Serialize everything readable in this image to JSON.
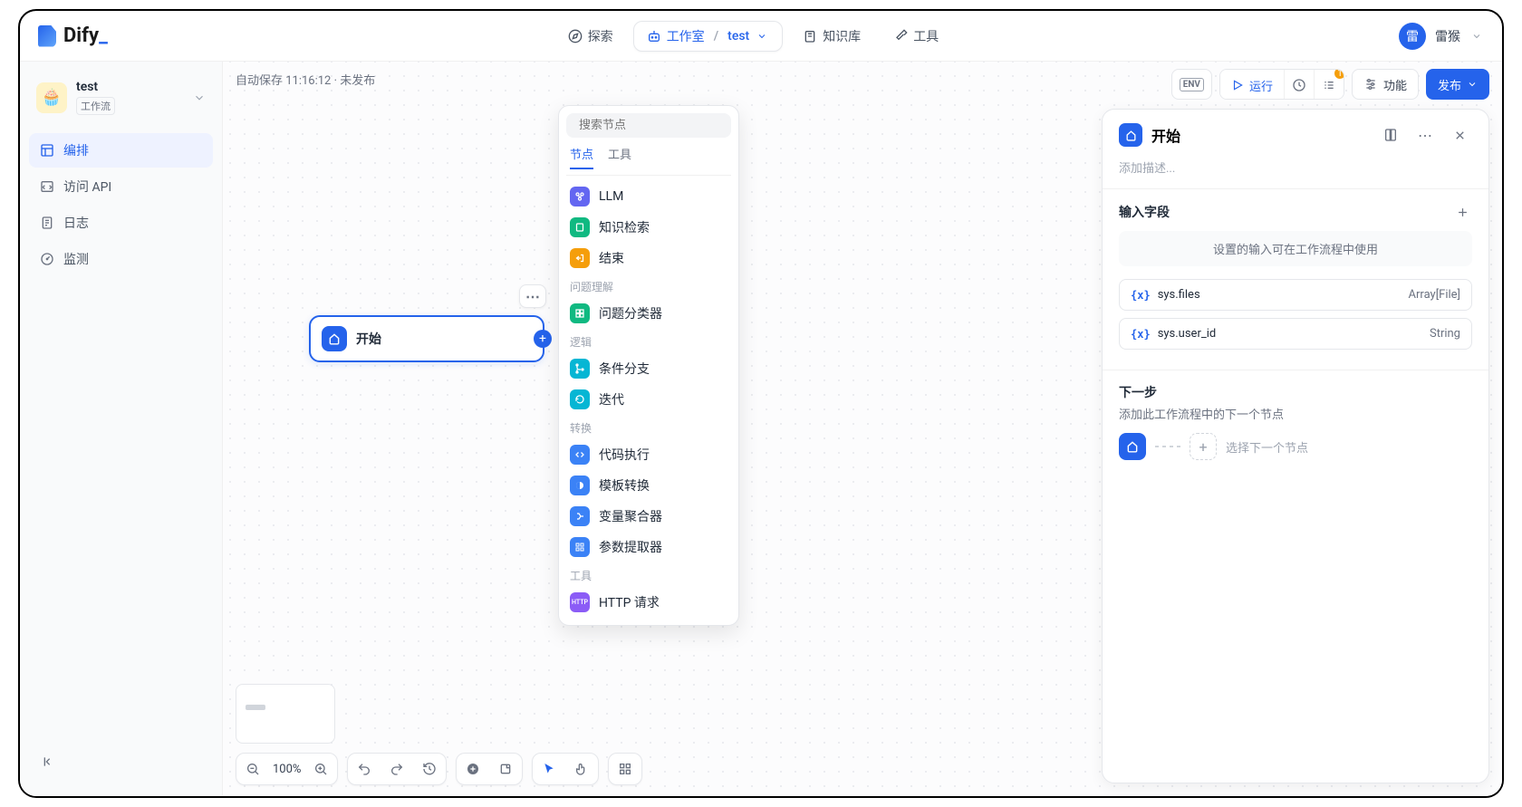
{
  "brand": {
    "name": "Dify",
    "suffix": "_"
  },
  "topnav": {
    "explore": "探索",
    "studio": "工作室",
    "project": "test",
    "knowledge": "知识库",
    "tools": "工具"
  },
  "user": {
    "initial": "雷",
    "name": "雷猴"
  },
  "sidebar": {
    "app_name": "test",
    "app_type": "工作流",
    "items": [
      {
        "label": "编排",
        "icon": "layout-icon"
      },
      {
        "label": "访问 API",
        "icon": "api-icon"
      },
      {
        "label": "日志",
        "icon": "log-icon"
      },
      {
        "label": "监测",
        "icon": "gauge-icon"
      }
    ]
  },
  "status": {
    "autosave": "自动保存 11:16:12 · 未发布"
  },
  "toolbar": {
    "env": "ENV",
    "run": "运行",
    "badge": "1",
    "features": "功能",
    "publish": "发布"
  },
  "node": {
    "start_label": "开始"
  },
  "palette": {
    "search_placeholder": "搜索节点",
    "tab_nodes": "节点",
    "tab_tools": "工具",
    "items": {
      "llm": "LLM",
      "knowledge": "知识检索",
      "end": "结束",
      "section_qa": "问题理解",
      "classifier": "问题分类器",
      "section_logic": "逻辑",
      "if": "条件分支",
      "loop": "迭代",
      "section_transform": "转换",
      "code": "代码执行",
      "template": "模板转换",
      "merge": "变量聚合器",
      "extract": "参数提取器",
      "section_tools": "工具",
      "http": "HTTP 请求"
    }
  },
  "controls": {
    "zoom": "100%"
  },
  "details": {
    "title": "开始",
    "desc_placeholder": "添加描述...",
    "input_fields_title": "输入字段",
    "input_hint": "设置的输入可在工作流程中使用",
    "vars": [
      {
        "name": "sys.files",
        "type": "Array[File]"
      },
      {
        "name": "sys.user_id",
        "type": "String"
      }
    ],
    "next_title": "下一步",
    "next_desc": "添加此工作流程中的下一个节点",
    "next_placeholder": "选择下一个节点"
  }
}
